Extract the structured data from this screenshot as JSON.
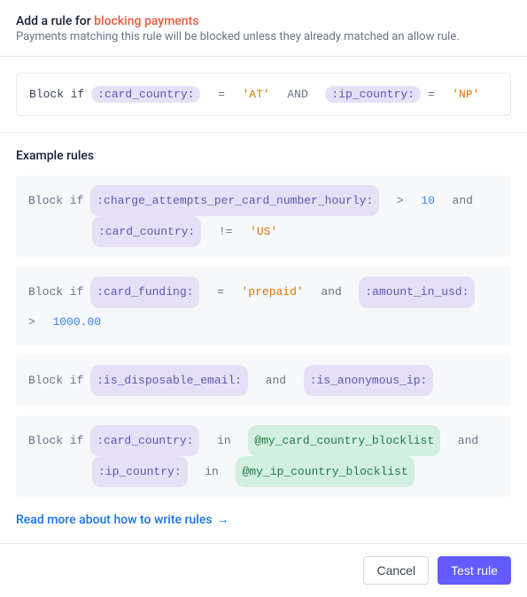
{
  "header": {
    "title_prefix": "Add a rule for ",
    "title_highlight": "blocking payments",
    "subtitle": "Payments matching this rule will be blocked unless they already matched an allow rule."
  },
  "rule_input": {
    "prefix": "Block if ",
    "field1": ":card_country:",
    "op1": "=",
    "val1": "'AT'",
    "kw1": "AND",
    "field2": ":ip_country:",
    "op2": "=",
    "val2": "'NP'"
  },
  "examples": {
    "title": "Example rules",
    "ex1": {
      "prefix": "Block if ",
      "field1": ":charge_attempts_per_card_number_hourly:",
      "op1": ">",
      "val1": "10",
      "kw1": "and",
      "field2": ":card_country:",
      "op2": "!=",
      "val2": "'US'"
    },
    "ex2": {
      "prefix": "Block if ",
      "field1": ":card_funding:",
      "op1": "=",
      "val1": "'prepaid'",
      "kw1": "and",
      "field2": ":amount_in_usd:",
      "op2": ">",
      "val2": "1000.00"
    },
    "ex3": {
      "prefix": "Block if ",
      "field1": ":is_disposable_email:",
      "kw1": "and",
      "field2": ":is_anonymous_ip:"
    },
    "ex4": {
      "prefix": "Block if ",
      "field1": ":card_country:",
      "op1": "in",
      "var1": "@my_card_country_blocklist",
      "kw1": "and",
      "field2": ":ip_country:",
      "op2": "in",
      "var2": "@my_ip_country_blocklist"
    }
  },
  "docs_link": "Read more about how to write rules",
  "footer": {
    "cancel": "Cancel",
    "test": "Test rule"
  }
}
